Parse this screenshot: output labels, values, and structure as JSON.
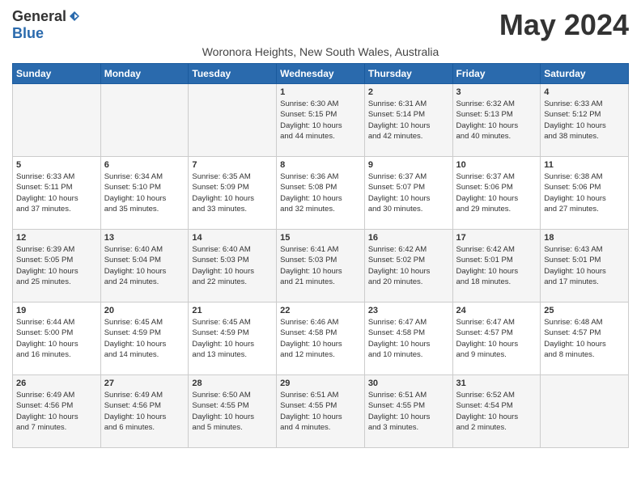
{
  "logo": {
    "general": "General",
    "blue": "Blue"
  },
  "title": "May 2024",
  "subtitle": "Woronora Heights, New South Wales, Australia",
  "days_of_week": [
    "Sunday",
    "Monday",
    "Tuesday",
    "Wednesday",
    "Thursday",
    "Friday",
    "Saturday"
  ],
  "weeks": [
    [
      {
        "day": "",
        "info": ""
      },
      {
        "day": "",
        "info": ""
      },
      {
        "day": "",
        "info": ""
      },
      {
        "day": "1",
        "info": "Sunrise: 6:30 AM\nSunset: 5:15 PM\nDaylight: 10 hours\nand 44 minutes."
      },
      {
        "day": "2",
        "info": "Sunrise: 6:31 AM\nSunset: 5:14 PM\nDaylight: 10 hours\nand 42 minutes."
      },
      {
        "day": "3",
        "info": "Sunrise: 6:32 AM\nSunset: 5:13 PM\nDaylight: 10 hours\nand 40 minutes."
      },
      {
        "day": "4",
        "info": "Sunrise: 6:33 AM\nSunset: 5:12 PM\nDaylight: 10 hours\nand 38 minutes."
      }
    ],
    [
      {
        "day": "5",
        "info": "Sunrise: 6:33 AM\nSunset: 5:11 PM\nDaylight: 10 hours\nand 37 minutes."
      },
      {
        "day": "6",
        "info": "Sunrise: 6:34 AM\nSunset: 5:10 PM\nDaylight: 10 hours\nand 35 minutes."
      },
      {
        "day": "7",
        "info": "Sunrise: 6:35 AM\nSunset: 5:09 PM\nDaylight: 10 hours\nand 33 minutes."
      },
      {
        "day": "8",
        "info": "Sunrise: 6:36 AM\nSunset: 5:08 PM\nDaylight: 10 hours\nand 32 minutes."
      },
      {
        "day": "9",
        "info": "Sunrise: 6:37 AM\nSunset: 5:07 PM\nDaylight: 10 hours\nand 30 minutes."
      },
      {
        "day": "10",
        "info": "Sunrise: 6:37 AM\nSunset: 5:06 PM\nDaylight: 10 hours\nand 29 minutes."
      },
      {
        "day": "11",
        "info": "Sunrise: 6:38 AM\nSunset: 5:06 PM\nDaylight: 10 hours\nand 27 minutes."
      }
    ],
    [
      {
        "day": "12",
        "info": "Sunrise: 6:39 AM\nSunset: 5:05 PM\nDaylight: 10 hours\nand 25 minutes."
      },
      {
        "day": "13",
        "info": "Sunrise: 6:40 AM\nSunset: 5:04 PM\nDaylight: 10 hours\nand 24 minutes."
      },
      {
        "day": "14",
        "info": "Sunrise: 6:40 AM\nSunset: 5:03 PM\nDaylight: 10 hours\nand 22 minutes."
      },
      {
        "day": "15",
        "info": "Sunrise: 6:41 AM\nSunset: 5:03 PM\nDaylight: 10 hours\nand 21 minutes."
      },
      {
        "day": "16",
        "info": "Sunrise: 6:42 AM\nSunset: 5:02 PM\nDaylight: 10 hours\nand 20 minutes."
      },
      {
        "day": "17",
        "info": "Sunrise: 6:42 AM\nSunset: 5:01 PM\nDaylight: 10 hours\nand 18 minutes."
      },
      {
        "day": "18",
        "info": "Sunrise: 6:43 AM\nSunset: 5:01 PM\nDaylight: 10 hours\nand 17 minutes."
      }
    ],
    [
      {
        "day": "19",
        "info": "Sunrise: 6:44 AM\nSunset: 5:00 PM\nDaylight: 10 hours\nand 16 minutes."
      },
      {
        "day": "20",
        "info": "Sunrise: 6:45 AM\nSunset: 4:59 PM\nDaylight: 10 hours\nand 14 minutes."
      },
      {
        "day": "21",
        "info": "Sunrise: 6:45 AM\nSunset: 4:59 PM\nDaylight: 10 hours\nand 13 minutes."
      },
      {
        "day": "22",
        "info": "Sunrise: 6:46 AM\nSunset: 4:58 PM\nDaylight: 10 hours\nand 12 minutes."
      },
      {
        "day": "23",
        "info": "Sunrise: 6:47 AM\nSunset: 4:58 PM\nDaylight: 10 hours\nand 10 minutes."
      },
      {
        "day": "24",
        "info": "Sunrise: 6:47 AM\nSunset: 4:57 PM\nDaylight: 10 hours\nand 9 minutes."
      },
      {
        "day": "25",
        "info": "Sunrise: 6:48 AM\nSunset: 4:57 PM\nDaylight: 10 hours\nand 8 minutes."
      }
    ],
    [
      {
        "day": "26",
        "info": "Sunrise: 6:49 AM\nSunset: 4:56 PM\nDaylight: 10 hours\nand 7 minutes."
      },
      {
        "day": "27",
        "info": "Sunrise: 6:49 AM\nSunset: 4:56 PM\nDaylight: 10 hours\nand 6 minutes."
      },
      {
        "day": "28",
        "info": "Sunrise: 6:50 AM\nSunset: 4:55 PM\nDaylight: 10 hours\nand 5 minutes."
      },
      {
        "day": "29",
        "info": "Sunrise: 6:51 AM\nSunset: 4:55 PM\nDaylight: 10 hours\nand 4 minutes."
      },
      {
        "day": "30",
        "info": "Sunrise: 6:51 AM\nSunset: 4:55 PM\nDaylight: 10 hours\nand 3 minutes."
      },
      {
        "day": "31",
        "info": "Sunrise: 6:52 AM\nSunset: 4:54 PM\nDaylight: 10 hours\nand 2 minutes."
      },
      {
        "day": "",
        "info": ""
      }
    ]
  ]
}
